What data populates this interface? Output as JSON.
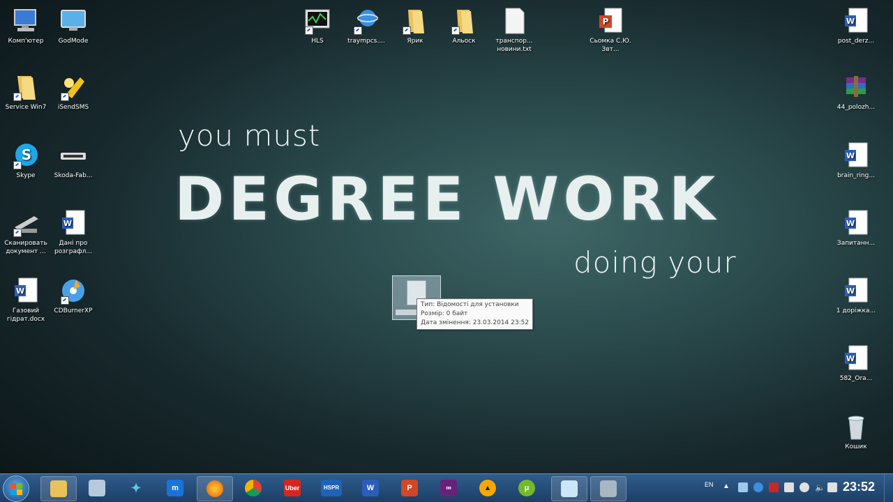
{
  "desktop": {
    "left_icons": [
      {
        "label": "Комп'ютер",
        "icon": "computer-icon"
      },
      {
        "label": "GodMode",
        "icon": "control-panel-icon"
      },
      {
        "label": "Service Win7",
        "icon": "folder-icon"
      },
      {
        "label": "iSendSMS",
        "icon": "sms-app-icon"
      },
      {
        "label": "Skype",
        "icon": "skype-icon"
      },
      {
        "label": "Skoda-Fab...",
        "icon": "device-icon"
      },
      {
        "label": "Сканировать документ ...",
        "icon": "scanner-icon"
      },
      {
        "label": "Дані про розграфл...",
        "icon": "word-doc-icon"
      },
      {
        "label": "Газовий гідрат.docx",
        "icon": "word-doc-icon"
      },
      {
        "label": "CDBurnerXP",
        "icon": "cd-burner-icon"
      }
    ],
    "top_icons": [
      {
        "label": "HLS",
        "icon": "monitor-app-icon"
      },
      {
        "label": "traympcs....",
        "icon": "network-icon"
      },
      {
        "label": "Ярик",
        "icon": "folder-icon"
      },
      {
        "label": "Альоск",
        "icon": "folder-icon"
      },
      {
        "label": "транспор... новини.txt",
        "icon": "text-file-icon"
      },
      {
        "label": "Сьомка С.Ю. Звт...",
        "icon": "powerpoint-icon"
      }
    ],
    "right_icons": [
      {
        "label": "post_derz...",
        "icon": "word-doc-icon"
      },
      {
        "label": "44_polozh...",
        "icon": "winrar-icon"
      },
      {
        "label": "brain_ring...",
        "icon": "word-doc-icon"
      },
      {
        "label": "Запитанн...",
        "icon": "word-doc-icon"
      },
      {
        "label": "1 доріжка...",
        "icon": "word-doc-icon"
      },
      {
        "label": "582_Ora...",
        "icon": "word-doc-icon"
      },
      {
        "label": "Кошик",
        "icon": "recycle-bin-icon"
      }
    ]
  },
  "wallpaper": {
    "line1": "you must",
    "line2": "DEGREE WORK",
    "line3": "doing your"
  },
  "tooltip": {
    "type": "Тип: Відомості для установки",
    "size": "Розмір: 0 байт",
    "date": "Дата змінення: 23.03.2014 23:52"
  },
  "taskbar": {
    "apps": [
      {
        "icon": "file-explorer-icon",
        "active": true
      },
      {
        "icon": "paint-icon",
        "active": false
      },
      {
        "icon": "bird-app-icon",
        "active": false
      },
      {
        "icon": "maxthon-icon",
        "active": false
      },
      {
        "icon": "firefox-icon",
        "active": true
      },
      {
        "icon": "chrome-icon",
        "active": false
      },
      {
        "icon": "uber-app-icon",
        "text": "Uber",
        "active": false
      },
      {
        "icon": "hspr-app-icon",
        "text": "HSPR",
        "active": false
      },
      {
        "icon": "word-icon",
        "text": "W",
        "active": false
      },
      {
        "icon": "powerpoint-icon",
        "text": "P",
        "active": false
      },
      {
        "icon": "visual-studio-icon",
        "active": false
      },
      {
        "icon": "aimp-icon",
        "active": false
      },
      {
        "icon": "utorrent-icon",
        "active": false
      },
      {
        "icon": "remote-desktop-icon",
        "active": true
      },
      {
        "icon": "scanner-task-icon",
        "active": true
      }
    ],
    "language": "EN",
    "clock": "23:52"
  }
}
